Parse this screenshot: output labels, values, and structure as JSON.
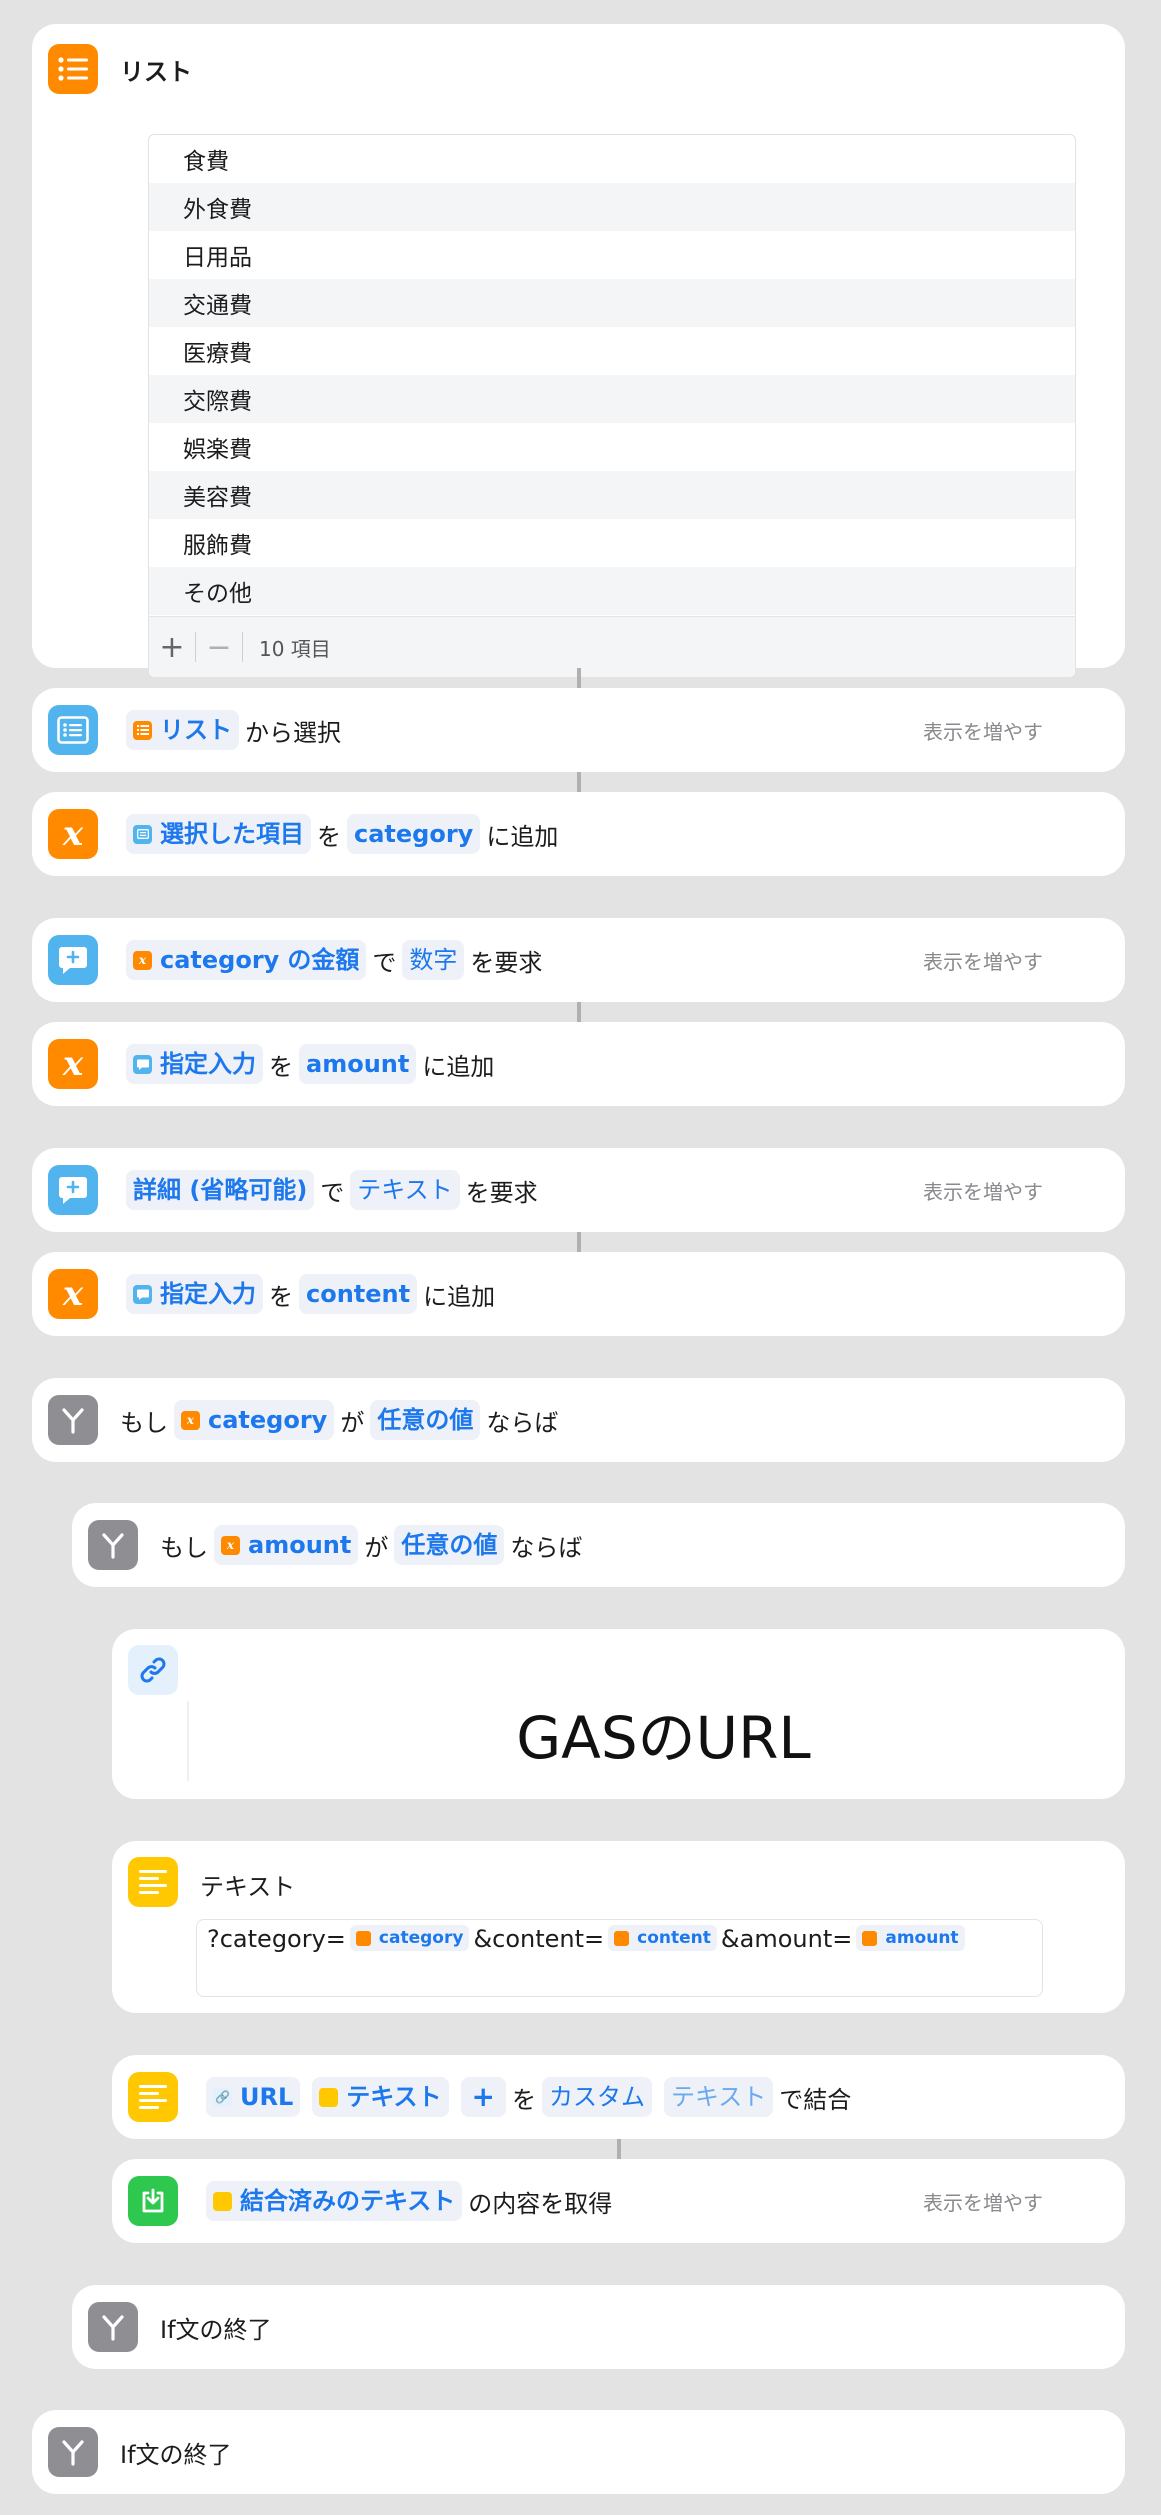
{
  "list_block": {
    "title": "リスト",
    "items": [
      "食費",
      "外食費",
      "日用品",
      "交通費",
      "医療費",
      "交際費",
      "娯楽費",
      "美容費",
      "服飾費",
      "その他"
    ],
    "add_symbol": "+",
    "remove_symbol": "−",
    "count_label": "10 項目"
  },
  "choose_from_list": {
    "token_list": "リスト",
    "suffix": "から選択",
    "more": "表示を増やす"
  },
  "set_category": {
    "token_selected": "選択した項目",
    "mid": "を",
    "var": "category",
    "suffix": "に追加"
  },
  "ask_amount": {
    "token_var": "category",
    "token_suffix": "の金額",
    "mid": "で",
    "type": "数字",
    "suffix": "を要求",
    "more": "表示を増やす"
  },
  "set_amount": {
    "token_input": "指定入力",
    "mid": "を",
    "var": "amount",
    "suffix": "に追加"
  },
  "ask_detail": {
    "prompt": "詳細 (省略可能)",
    "mid": "で",
    "type": "テキスト",
    "suffix": "を要求",
    "more": "表示を増やす"
  },
  "set_content": {
    "token_input": "指定入力",
    "mid": "を",
    "var": "content",
    "suffix": "に追加"
  },
  "if_category": {
    "prefix": "もし",
    "var": "category",
    "mid": "が",
    "cond": "任意の値",
    "suffix": "ならば"
  },
  "if_amount": {
    "prefix": "もし",
    "var": "amount",
    "mid": "が",
    "cond": "任意の値",
    "suffix": "ならば"
  },
  "url_block": {
    "url": "GASのURL"
  },
  "text_block": {
    "title": "テキスト",
    "part1": "?category=",
    "var1": "category",
    "part2": "&content=",
    "var2": "content",
    "part3": "&amount=",
    "var3": "amount"
  },
  "combine": {
    "token_url": "URL",
    "token_text": "テキスト",
    "plus": "+",
    "mid": "を",
    "custom": "カスタム",
    "text_plain": "テキスト",
    "suffix": "で結合"
  },
  "get_contents": {
    "token": "結合済みのテキスト",
    "suffix": "の内容を取得",
    "more": "表示を増やす"
  },
  "end_if_inner": {
    "label": "If文の終了"
  },
  "end_if_outer": {
    "label": "If文の終了"
  },
  "colors": {
    "accent_blue": "#1c78ec",
    "orange": "#ff8a00",
    "light_blue": "#52b4ee",
    "gray": "#8e8e93",
    "yellow": "#ffc800",
    "green": "#2dc84d"
  }
}
